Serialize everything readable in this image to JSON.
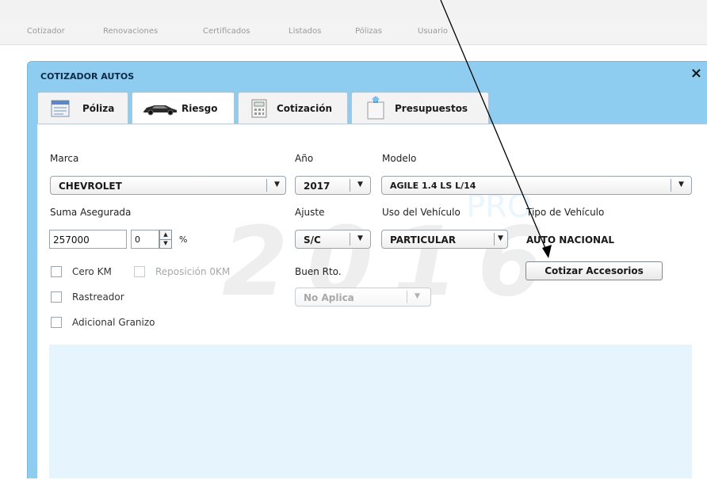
{
  "menu": [
    "Cotizador",
    "Renovaciones",
    "Certificados",
    "Listados",
    "Pólizas",
    "Usuario"
  ],
  "window": {
    "title": "COTIZADOR AUTOS",
    "close": "×"
  },
  "tabs": [
    {
      "label": "Póliza",
      "icon": "document-icon"
    },
    {
      "label": "Riesgo",
      "icon": "car-icon",
      "active": true
    },
    {
      "label": "Cotización",
      "icon": "calculator-icon"
    },
    {
      "label": "Presupuestos",
      "icon": "notepad-icon"
    }
  ],
  "form": {
    "marca": {
      "label": "Marca",
      "value": "CHEVROLET"
    },
    "anio": {
      "label": "Año",
      "value": "2017"
    },
    "modelo": {
      "label": "Modelo",
      "value": "AGILE 1.4 LS  L/14"
    },
    "suma": {
      "label": "Suma Asegurada",
      "value": "257000",
      "percent_value": "0",
      "percent_symbol": "%"
    },
    "ajuste": {
      "label": "Ajuste",
      "value": "S/C"
    },
    "uso": {
      "label": "Uso del Vehículo",
      "value": "PARTICULAR"
    },
    "tipo": {
      "label": "Tipo de Vehículo",
      "value": "AUTO NACIONAL"
    },
    "buen_rto": {
      "label": "Buen Rto.",
      "value": "No Aplica"
    },
    "checkboxes": {
      "cero_km": "Cero KM",
      "reposicion": "Reposición 0KM",
      "rastreador": "Rastreador",
      "granizo": "Adicional Granizo"
    },
    "cotizar_btn": "Cotizar Accesorios"
  },
  "watermark": {
    "year": "2016",
    "brand": "PRO"
  },
  "colors": {
    "window_header": "#8ecdf0",
    "panel": "#e6f5fd"
  }
}
